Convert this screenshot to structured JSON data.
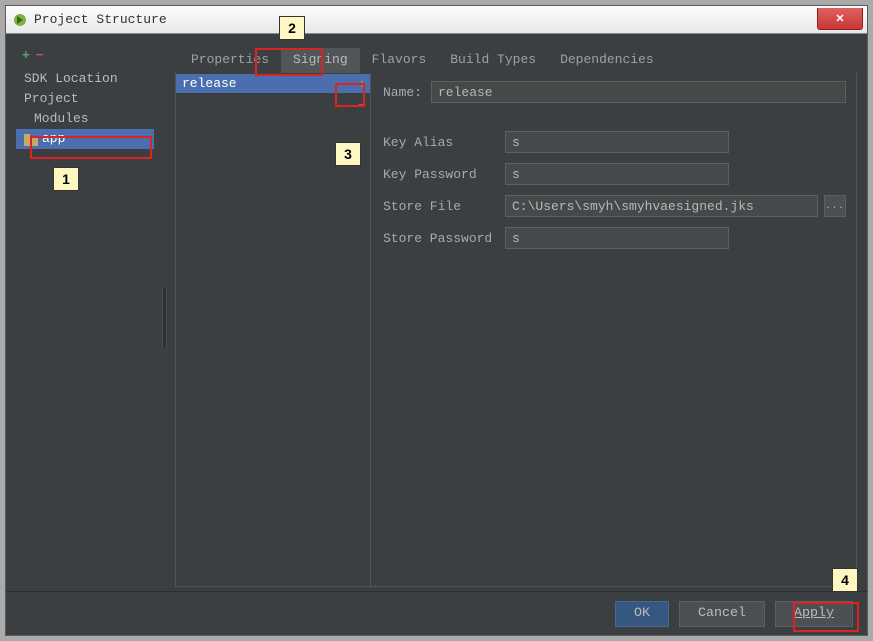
{
  "window": {
    "title": "Project Structure"
  },
  "sidebar": {
    "items": [
      "SDK Location",
      "Project"
    ],
    "group_label": "Modules",
    "module": "app"
  },
  "tabs": [
    "Properties",
    "Signing",
    "Flavors",
    "Build Types",
    "Dependencies"
  ],
  "active_tab": "Signing",
  "config_list": {
    "selected": "release"
  },
  "form": {
    "name_label": "Name:",
    "name_value": "release",
    "key_alias_label": "Key Alias",
    "key_alias_value": "s",
    "key_password_label": "Key Password",
    "key_password_value": "s",
    "store_file_label": "Store File",
    "store_file_value": "C:\\Users\\smyh\\smyhvaesigned.jks",
    "store_password_label": "Store Password",
    "store_password_value": "s",
    "browse": "..."
  },
  "buttons": {
    "ok": "OK",
    "cancel": "Cancel",
    "apply": "Apply"
  },
  "callouts": {
    "n1": "1",
    "n2": "2",
    "n3": "3",
    "n4": "4"
  }
}
